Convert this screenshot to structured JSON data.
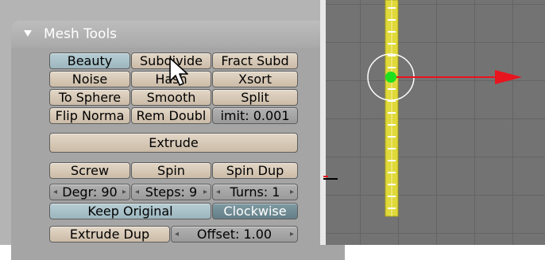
{
  "panel": {
    "title": "Mesh Tools",
    "row1": [
      "Beauty",
      "Subdivide",
      "Fract Subd"
    ],
    "row2": [
      "Noise",
      "Hash",
      "Xsort"
    ],
    "row3": [
      "To Sphere",
      "Smooth",
      "Split"
    ],
    "row4": [
      "Flip Norma",
      "Rem Doubl",
      "imit: 0.001"
    ],
    "extrude": "Extrude",
    "row6": [
      "Screw",
      "Spin",
      "Spin Dup"
    ],
    "row7": [
      "Degr: 90",
      "Steps: 9",
      "Turns: 1"
    ],
    "keep_original": "Keep Original",
    "clockwise": "Clockwise",
    "extrude_dup": "Extrude Dup",
    "offset": "Offset: 1.00"
  },
  "colors": {
    "button": "#d6c8b6",
    "button_blue": "#a9c2ca",
    "button_selected": "#708c95",
    "viewport_bg": "#737373",
    "edge_yellow": "#e0d93a",
    "axis_red": "#e8141e",
    "center_green": "#1fe01f"
  },
  "icons": {
    "collapse": "triangle-down-icon",
    "cursor": "mouse-pointer-icon",
    "widget": "translate-manipulator-icon"
  }
}
